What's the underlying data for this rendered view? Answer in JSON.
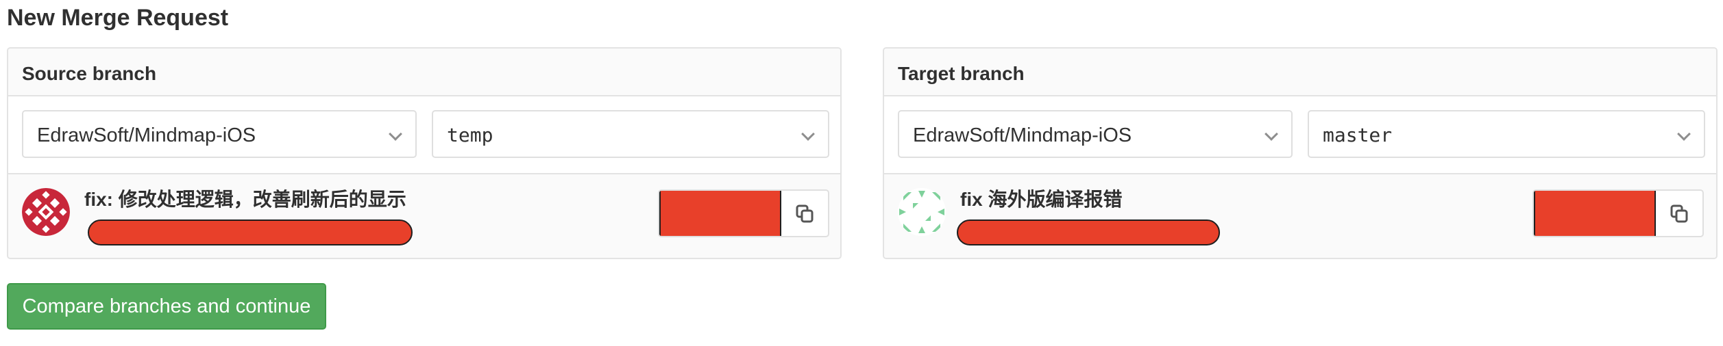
{
  "page": {
    "title": "New Merge Request"
  },
  "source": {
    "header": "Source branch",
    "project": "EdrawSoft/Mindmap-iOS",
    "branch": "temp",
    "commit": {
      "title": "fix: 修改处理逻辑，改善刷新后的显示",
      "avatar_icon": "identicon-red",
      "sha_redacted": true,
      "meta_redacted": true
    }
  },
  "target": {
    "header": "Target branch",
    "project": "EdrawSoft/Mindmap-iOS",
    "branch": "master",
    "commit": {
      "title": "fix 海外版编译报错",
      "avatar_icon": "identicon-green",
      "sha_redacted": true,
      "meta_redacted": true
    }
  },
  "actions": {
    "compare_label": "Compare branches and continue"
  },
  "colors": {
    "accent_green": "#52a95c",
    "redaction_red": "#e8402a",
    "avatar_red": "#c8273a",
    "avatar_green": "#7fd19b"
  }
}
